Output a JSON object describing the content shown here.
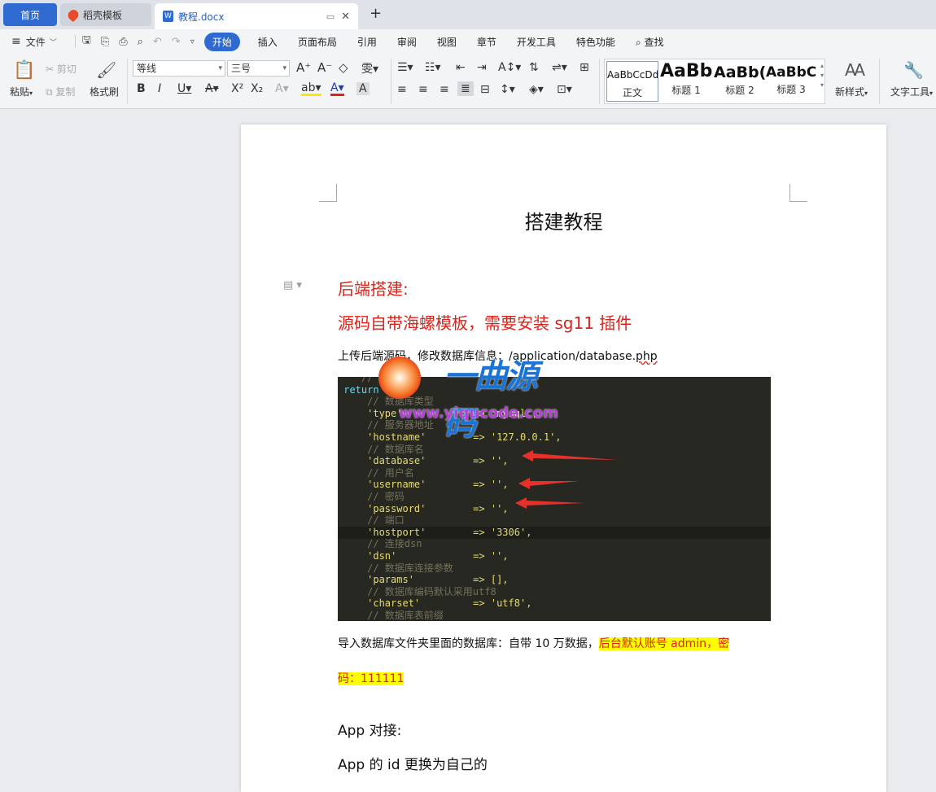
{
  "tabs": {
    "home": "首页",
    "template": "稻壳模板",
    "doc": "教程.docx"
  },
  "menu": {
    "file": "文件",
    "items": [
      "开始",
      "插入",
      "页面布局",
      "引用",
      "审阅",
      "视图",
      "章节",
      "开发工具",
      "特色功能"
    ],
    "search": "查找"
  },
  "ribbon": {
    "paste": "粘贴",
    "cut": "剪切",
    "copy": "复制",
    "format_painter": "格式刷",
    "font_name": "等线",
    "font_size": "三号",
    "styles": [
      {
        "preview": "AaBbCcDd",
        "label": "正文"
      },
      {
        "preview": "AaBb",
        "label": "标题 1"
      },
      {
        "preview": "AaBb(",
        "label": "标题 2"
      },
      {
        "preview": "AaBbC(",
        "label": "标题 3"
      }
    ],
    "new_style": "新样式",
    "text_tools": "文字工具"
  },
  "document": {
    "title": "搭建教程",
    "h1": "后端搭建:",
    "h2": "源码自带海螺模板，需要安装 sg11 插件",
    "p1_prefix": "上传后端源码，修改数",
    "p1_hidden": "据库信息",
    "p1_suffix": "：/application/database.",
    "p1_php": "php",
    "p2_plain": "导入数据库文件夹里面的数据库：自带 10 万数据，",
    "p2_highlight_a": "后台默认账号 admin，密",
    "p2_highlight_b": "码：111111",
    "p3": "App 对接:",
    "p4": "App 的 id 更换为自己的"
  },
  "code_lines": [
    {
      "cls": "c-com",
      "t": "    //"
    },
    {
      "cls": "c-ret",
      "t": " return ["
    },
    {
      "cls": "c-com",
      "t": "     // 数据库类型"
    },
    {
      "cls": "c-key",
      "t": "     'type'            => 'mysql',"
    },
    {
      "cls": "c-com",
      "t": "     // 服务器地址"
    },
    {
      "cls": "c-key",
      "t": "     'hostname'        => '127.0.0.1',"
    },
    {
      "cls": "c-com",
      "t": "     // 数据库名"
    },
    {
      "cls": "c-key",
      "t": "     'database'        => '',"
    },
    {
      "cls": "c-com",
      "t": "     // 用户名"
    },
    {
      "cls": "c-key",
      "t": "     'username'        => '',"
    },
    {
      "cls": "c-com",
      "t": "     // 密码"
    },
    {
      "cls": "c-key",
      "t": "     'password'        => '',"
    },
    {
      "cls": "c-com",
      "t": "     // 端口"
    },
    {
      "cls": "c-key",
      "t": "     'hostport'        => '3306',"
    },
    {
      "cls": "c-com",
      "t": "     // 连接dsn"
    },
    {
      "cls": "c-key",
      "t": "     'dsn'             => '',"
    },
    {
      "cls": "c-com",
      "t": "     // 数据库连接参数"
    },
    {
      "cls": "c-key",
      "t": "     'params'          => [],"
    },
    {
      "cls": "c-com",
      "t": "     // 数据库编码默认采用utf8"
    },
    {
      "cls": "c-key",
      "t": "     'charset'         => 'utf8',"
    },
    {
      "cls": "c-com",
      "t": "     // 数据库表前缀"
    }
  ],
  "watermark": {
    "cn": "一曲源码",
    "url": "www.yiqucode.com"
  }
}
